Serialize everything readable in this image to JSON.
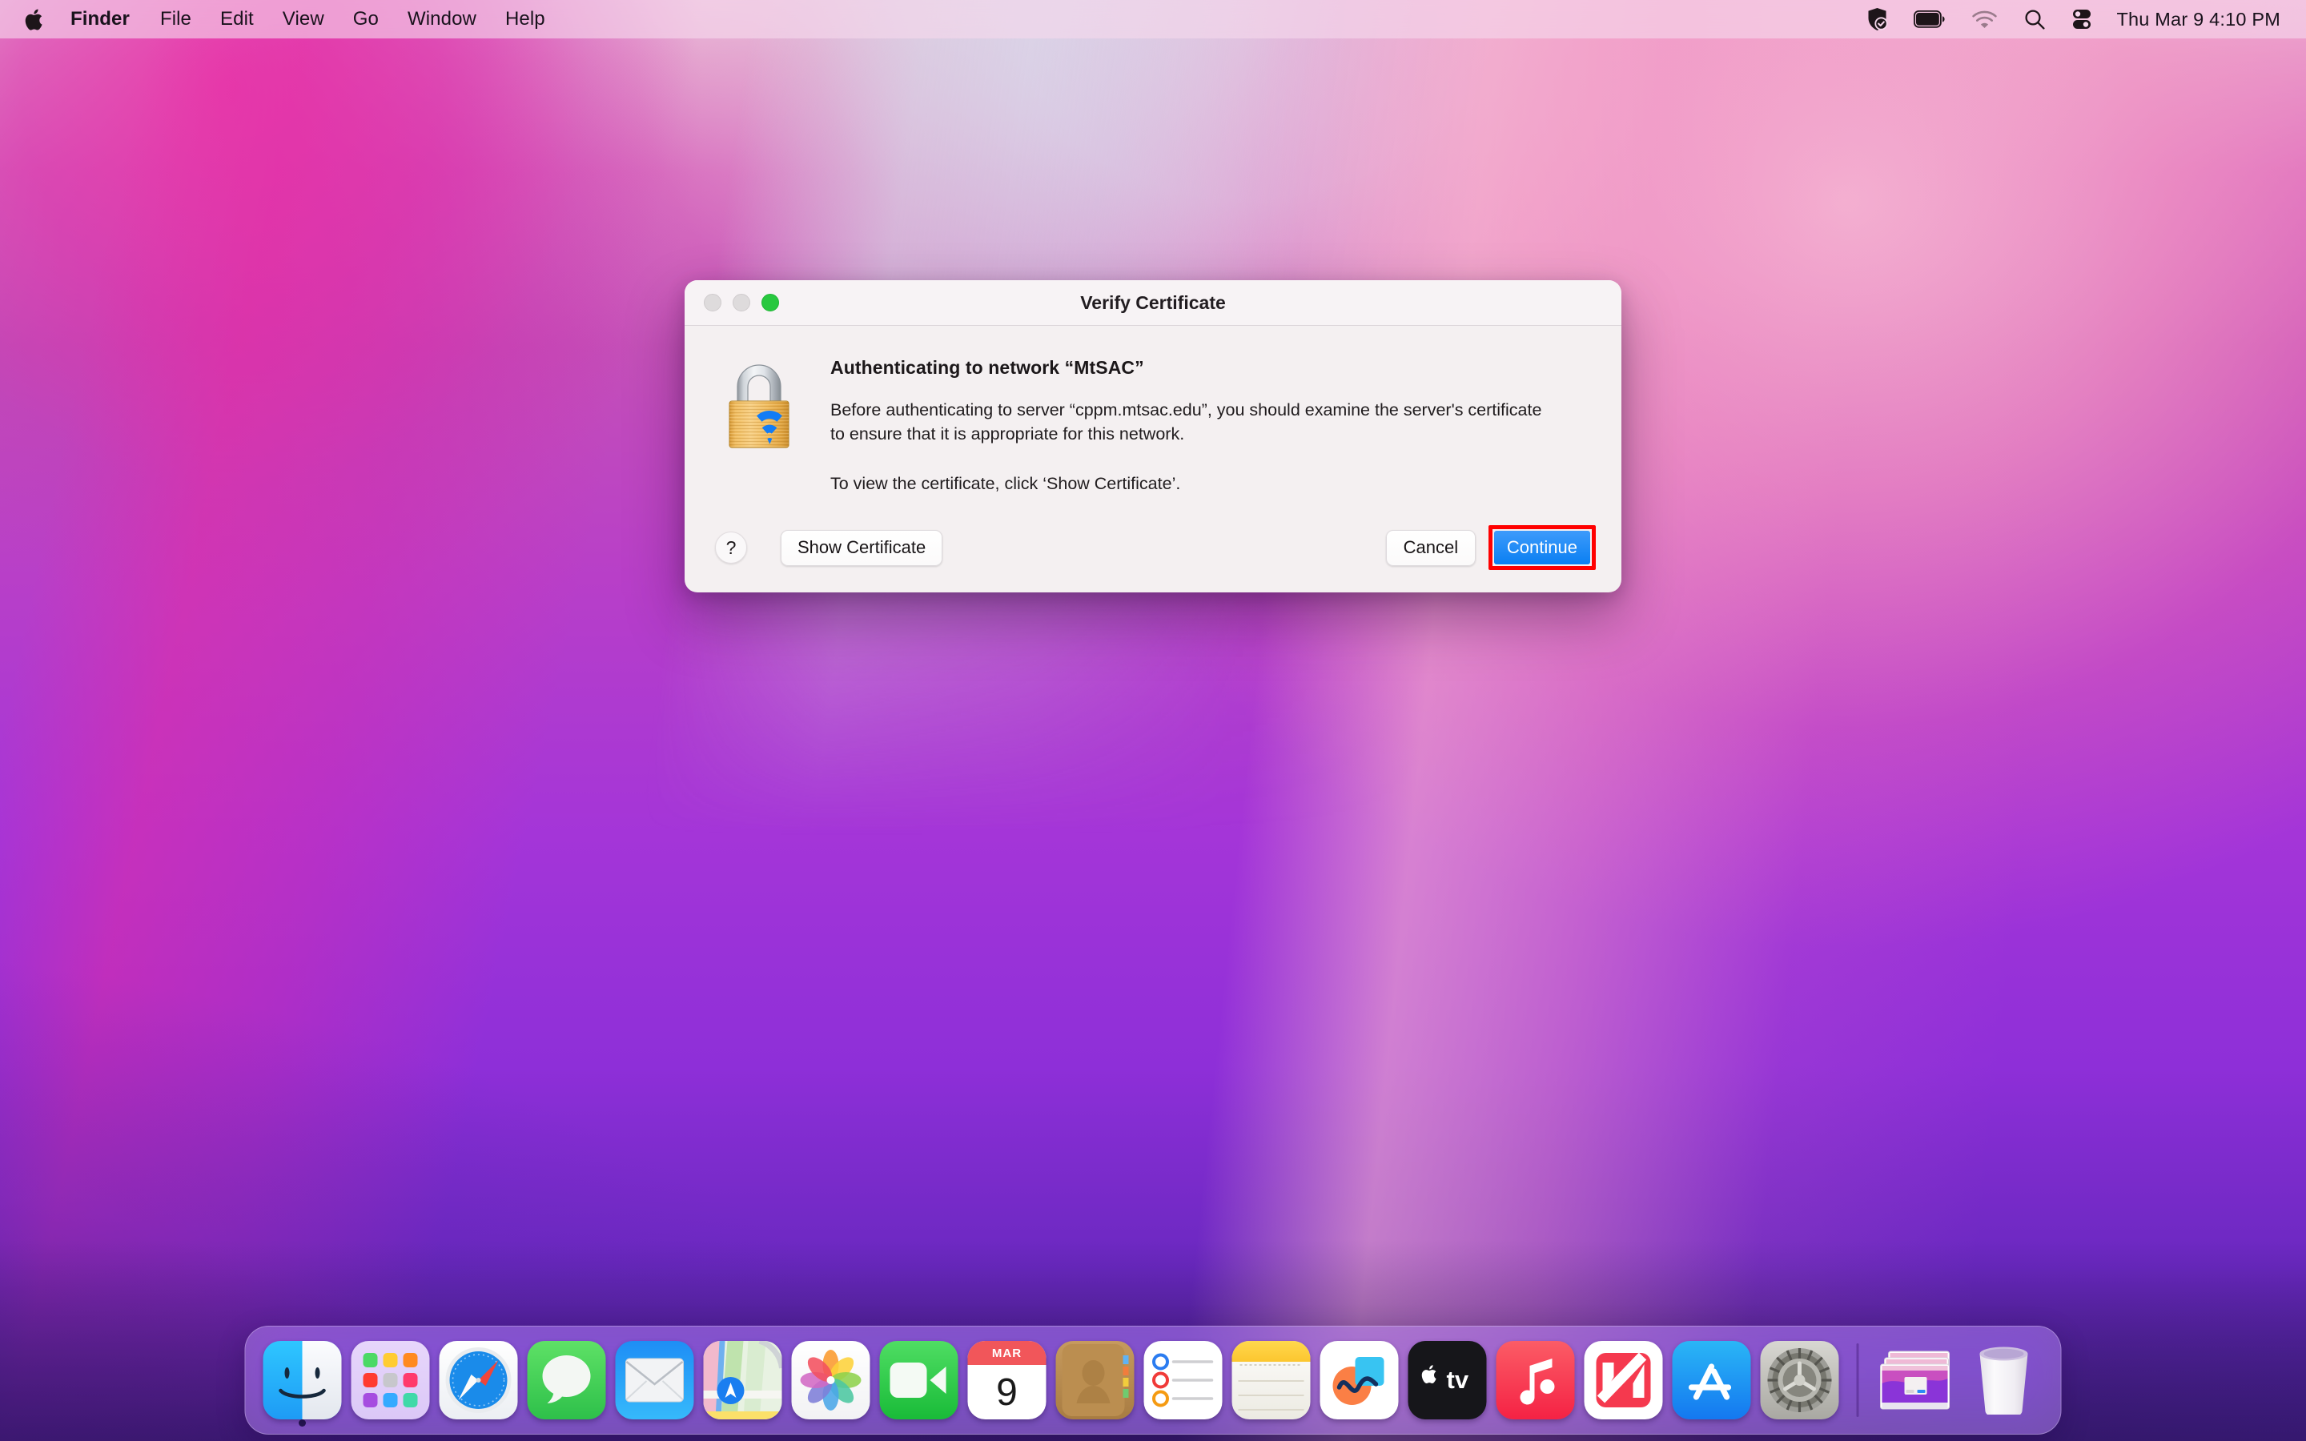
{
  "menubar": {
    "apple_icon": "apple-logo-icon",
    "app_name": "Finder",
    "items": [
      "File",
      "Edit",
      "View",
      "Go",
      "Window",
      "Help"
    ],
    "status_icons": [
      "shield-check-icon",
      "battery-icon",
      "wifi-icon",
      "search-icon",
      "control-center-icon"
    ],
    "clock": "Thu Mar 9  4:10 PM"
  },
  "dialog": {
    "title": "Verify Certificate",
    "icon": "wifi-lock-icon",
    "heading": "Authenticating to network “MtSAC”",
    "paragraph_1": "Before authenticating to server “cppm.mtsac.edu”, you should examine the server's certificate to ensure that it is appropriate for this network.",
    "paragraph_2": "To view the certificate, click ‘Show Certificate’.",
    "help_label": "?",
    "show_certificate_label": "Show Certificate",
    "cancel_label": "Cancel",
    "continue_label": "Continue",
    "traffic_lights": [
      "close-disabled",
      "minimize-disabled",
      "zoom-green"
    ],
    "highlight_color": "#ff0000",
    "accent_color": "#0a7ff2"
  },
  "dock": {
    "items": [
      {
        "name": "finder",
        "label": "Finder",
        "running": true
      },
      {
        "name": "launchpad",
        "label": "Launchpad",
        "running": false
      },
      {
        "name": "safari",
        "label": "Safari",
        "running": false
      },
      {
        "name": "messages",
        "label": "Messages",
        "running": false
      },
      {
        "name": "mail",
        "label": "Mail",
        "running": false
      },
      {
        "name": "maps",
        "label": "Maps",
        "running": false
      },
      {
        "name": "photos",
        "label": "Photos",
        "running": false
      },
      {
        "name": "facetime",
        "label": "FaceTime",
        "running": false
      },
      {
        "name": "calendar",
        "label": "Calendar",
        "running": false
      },
      {
        "name": "contacts",
        "label": "Contacts",
        "running": false
      },
      {
        "name": "reminders",
        "label": "Reminders",
        "running": false
      },
      {
        "name": "notes",
        "label": "Notes",
        "running": false
      },
      {
        "name": "freeform",
        "label": "Freeform",
        "running": false
      },
      {
        "name": "tv",
        "label": "TV",
        "running": false
      },
      {
        "name": "music",
        "label": "Music",
        "running": false
      },
      {
        "name": "news",
        "label": "News",
        "running": false
      },
      {
        "name": "appstore",
        "label": "App Store",
        "running": false
      },
      {
        "name": "system-settings",
        "label": "System Preferences",
        "running": false
      },
      {
        "name": "minimized-window",
        "label": "Minimized Window",
        "running": false
      },
      {
        "name": "trash",
        "label": "Trash",
        "running": false
      }
    ],
    "calendar_month": "MAR",
    "calendar_day": "9",
    "tv_label": "tv"
  }
}
